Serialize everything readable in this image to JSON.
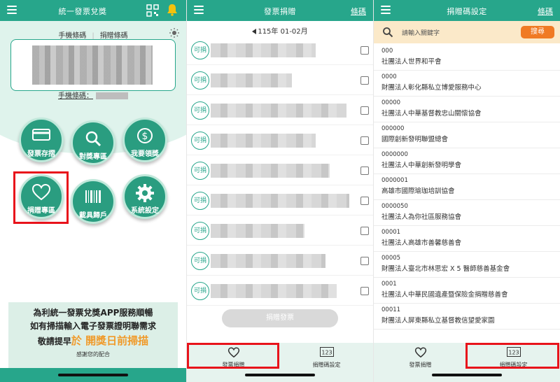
{
  "panel1": {
    "title": "統一發票兌獎",
    "tabs": [
      "手機條碼",
      "捐贈條碼"
    ],
    "phone_code_label": "手機條碼：",
    "buttons": [
      {
        "label": "發票存摺",
        "icon": "card-icon"
      },
      {
        "label": "對獎專區",
        "icon": "search-icon"
      },
      {
        "label": "我要領獎",
        "icon": "dollar-coin-icon"
      },
      {
        "label": "捐贈專區",
        "icon": "heart-icon"
      },
      {
        "label": "載具歸戶",
        "icon": "barcode-icon"
      },
      {
        "label": "系統設定",
        "icon": "gear-icon"
      }
    ],
    "banner": {
      "line1": "為利統一發票兌獎APP服務順暢",
      "line2": "如有掃描輸入電子發票證明聯需求",
      "line3_prefix": "敬請提早",
      "line3_highlight": "於 開獎日前掃描",
      "thanks": "感謝您的配合"
    }
  },
  "panel2": {
    "title": "發票捐贈",
    "header_link": "條碼",
    "period": "115年 01-02月",
    "donatable_label": "可捐",
    "row_count": 9,
    "donate_button": "捐贈發票",
    "tabs": [
      {
        "label": "發票捐贈",
        "icon": "heart-icon"
      },
      {
        "label": "捐贈碼設定",
        "icon": "123-icon"
      }
    ]
  },
  "panel3": {
    "title": "捐贈碼設定",
    "header_link": "條碼",
    "search_placeholder": "請輸入關鍵字",
    "search_button": "搜尋",
    "items": [
      {
        "code": "000",
        "name": "社團法人世界和平會"
      },
      {
        "code": "0000",
        "name": "財團法人彰化縣私立博愛服務中心"
      },
      {
        "code": "00000",
        "name": "社團法人中華基督教忠山關懷協會"
      },
      {
        "code": "000000",
        "name": "國際創新發明聯盟總會"
      },
      {
        "code": "0000000",
        "name": "社團法人中華創新發明學會"
      },
      {
        "code": "0000001",
        "name": "高雄市國際瑜珈培訓協會"
      },
      {
        "code": "0000050",
        "name": "社團法人為你社區服務協會"
      },
      {
        "code": "00001",
        "name": "社團法人高雄市善馨慈善會"
      },
      {
        "code": "00005",
        "name": "財團法人臺北市林思宏 X 5 醫師慈善基金會"
      },
      {
        "code": "0001",
        "name": "社團法人中華民國遺產暨保險金捐贈慈善會"
      },
      {
        "code": "00011",
        "name": "財團法人屏東縣私立基督教信望愛家園"
      }
    ],
    "tabs": [
      {
        "label": "發票捐贈",
        "icon": "heart-icon"
      },
      {
        "label": "捐贈碼設定",
        "icon": "123-icon"
      }
    ]
  },
  "colors": {
    "primary": "#27a68b",
    "highlight": "#e8131b",
    "search_bg": "#fbe9c9",
    "search_button": "#f07a24"
  }
}
